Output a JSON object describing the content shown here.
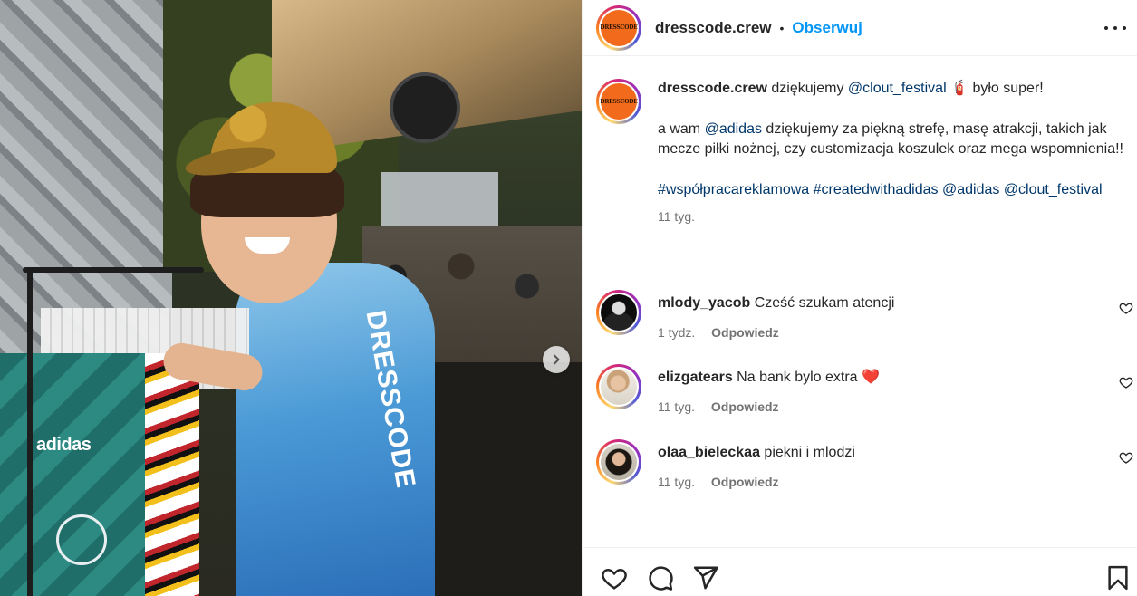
{
  "post": {
    "username": "dresscode.crew",
    "follow_label": "Obserwuj",
    "separator": "•",
    "avatar_text": "DRESSCODE",
    "shirt_logo": "adidas",
    "shirt_print": "DRESSCODE"
  },
  "caption": {
    "username": "dresscode.crew",
    "line1_before": "dziękujemy",
    "mention_clout": "@clout_festival",
    "extinguisher_emoji": "🧯",
    "line1_after": "było super!",
    "p2_before": "a wam",
    "mention_adidas": "@adidas",
    "p2_after": "dziękujemy za piękną strefę, masę atrakcji, takich jak mecze piłki nożnej, czy customizacja koszulek oraz mega wspomnienia!!",
    "hashtag1": "#współpracareklamowa",
    "hashtag2": "#createdwithadidas",
    "tag_adidas": "@adidas",
    "tag_clout": "@clout_festival",
    "time": "11 tyg."
  },
  "comments": [
    {
      "username": "mlody_yacob",
      "text": "Cześć szukam atencji",
      "time": "1 tydz.",
      "reply_label": "Odpowiedz"
    },
    {
      "username": "elizgatears",
      "text": "Na bank bylo extra",
      "emoji": "❤️",
      "time": "11 tyg.",
      "reply_label": "Odpowiedz"
    },
    {
      "username": "olaa_bieleckaa",
      "text": "piekni i mlodzi",
      "time": "11 tyg.",
      "reply_label": "Odpowiedz"
    }
  ],
  "icons": {
    "next": "chevron-right-icon",
    "more": "more-horizontal-icon",
    "like": "heart-icon",
    "comment": "comment-icon",
    "share": "paper-plane-icon",
    "save": "bookmark-icon"
  },
  "colors": {
    "accent": "#0095f6",
    "link": "#00376b",
    "brand_orange": "#f26a1b",
    "heart_red": "#ed1c24"
  }
}
